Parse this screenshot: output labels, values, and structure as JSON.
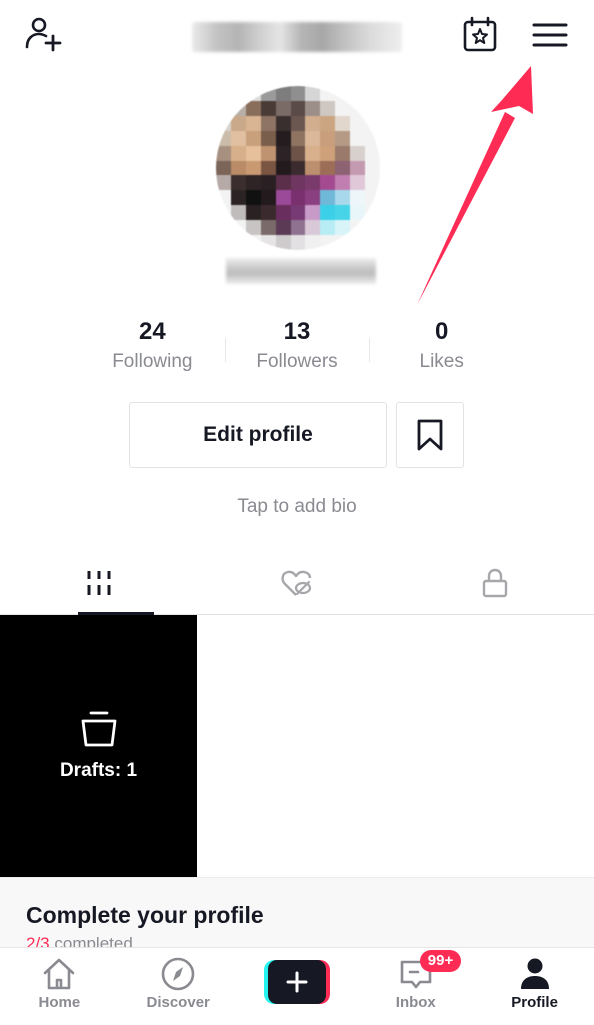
{
  "header": {
    "add_friend_icon": "person-plus-icon",
    "username": "",
    "calendar_icon": "calendar-star-icon",
    "menu_icon": "hamburger-menu-icon"
  },
  "profile": {
    "avatar": "blurred-profile-photo",
    "display_name": ""
  },
  "stats": [
    {
      "value": "24",
      "label": "Following"
    },
    {
      "value": "13",
      "label": "Followers"
    },
    {
      "value": "0",
      "label": "Likes"
    }
  ],
  "actions": {
    "edit_profile": "Edit profile",
    "bookmark_icon": "bookmark-icon"
  },
  "bio_placeholder": "Tap to add bio",
  "tabs": [
    {
      "icon": "grid-videos-icon",
      "active": true
    },
    {
      "icon": "liked-hidden-icon",
      "active": false
    },
    {
      "icon": "lock-private-icon",
      "active": false
    }
  ],
  "content": {
    "drafts_label": "Drafts: 1",
    "drafts_icon": "drafts-box-icon"
  },
  "complete_profile": {
    "title": "Complete your profile",
    "progress": "2/3",
    "progress_suffix": " completed"
  },
  "nav": {
    "items": [
      {
        "label": "Home",
        "icon": "home-icon"
      },
      {
        "label": "Discover",
        "icon": "compass-icon"
      },
      {
        "label": "",
        "icon": "plus-create-icon"
      },
      {
        "label": "Inbox",
        "icon": "inbox-icon",
        "badge": "99+"
      },
      {
        "label": "Profile",
        "icon": "profile-icon",
        "active": true
      }
    ]
  },
  "annotation": {
    "type": "arrow",
    "points_to": "menu-button",
    "color": "#fe2c55"
  },
  "colors": {
    "accent": "#fe2c55",
    "cyan": "#25f4ee",
    "text_primary": "#161823",
    "text_secondary": "#8a8b91"
  }
}
